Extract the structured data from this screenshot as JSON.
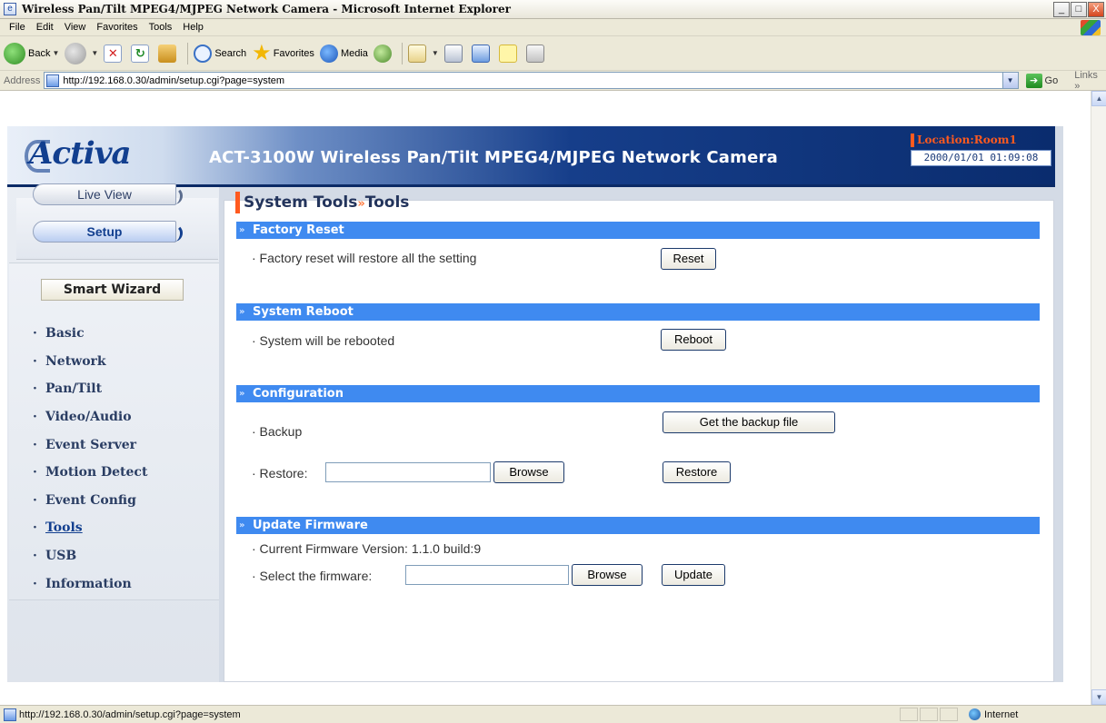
{
  "window": {
    "title": "Wireless Pan/Tilt MPEG4/MJPEG Network Camera - Microsoft Internet Explorer",
    "buttons": [
      "_",
      "□",
      "X"
    ]
  },
  "menubar": [
    "File",
    "Edit",
    "View",
    "Favorites",
    "Tools",
    "Help"
  ],
  "toolbar": {
    "back": "Back",
    "search": "Search",
    "favorites": "Favorites",
    "media": "Media"
  },
  "address": {
    "label": "Address",
    "url": "http://192.168.0.30/admin/setup.cgi?page=system",
    "go": "Go",
    "links": "Links »"
  },
  "header": {
    "logo": "Activa",
    "product": "ACT-3100W Wireless Pan/Tilt MPEG4/MJPEG Network Camera",
    "location": "Location:Room1",
    "datetime": "2000/01/01 01:09:08"
  },
  "sidebar": {
    "live_view": "Live View",
    "setup": "Setup",
    "smart_wizard": "Smart Wizard",
    "items": [
      "Basic",
      "Network",
      "Pan/Tilt",
      "Video/Audio",
      "Event Server",
      "Motion Detect",
      "Event Config",
      "Tools",
      "USB",
      "Information"
    ],
    "active": "Tools"
  },
  "main": {
    "title_part1": "System Tools",
    "title_sep": "»",
    "title_part2": "Tools",
    "factory_reset": {
      "header": "Factory Reset",
      "text": "· Factory reset will restore all the setting",
      "button": "Reset"
    },
    "system_reboot": {
      "header": "System Reboot",
      "text": "· System will be rebooted",
      "button": "Reboot"
    },
    "configuration": {
      "header": "Configuration",
      "backup_text": "· Backup",
      "backup_button": "Get the backup file",
      "restore_label": "· Restore:",
      "restore_value": "",
      "browse_button": "Browse",
      "restore_button": "Restore"
    },
    "update_firmware": {
      "header": "Update Firmware",
      "version_text": "· Current Firmware Version: 1.1.0 build:9",
      "select_label": "· Select the firmware:",
      "firmware_value": "",
      "browse_button": "Browse",
      "update_button": "Update"
    }
  },
  "statusbar": {
    "url": "http://192.168.0.30/admin/setup.cgi?page=system",
    "zone": "Internet"
  },
  "colors": {
    "section_bar": "#3f8af0",
    "accent": "#ff5a1f",
    "banner_dark": "#0a2c6e"
  }
}
